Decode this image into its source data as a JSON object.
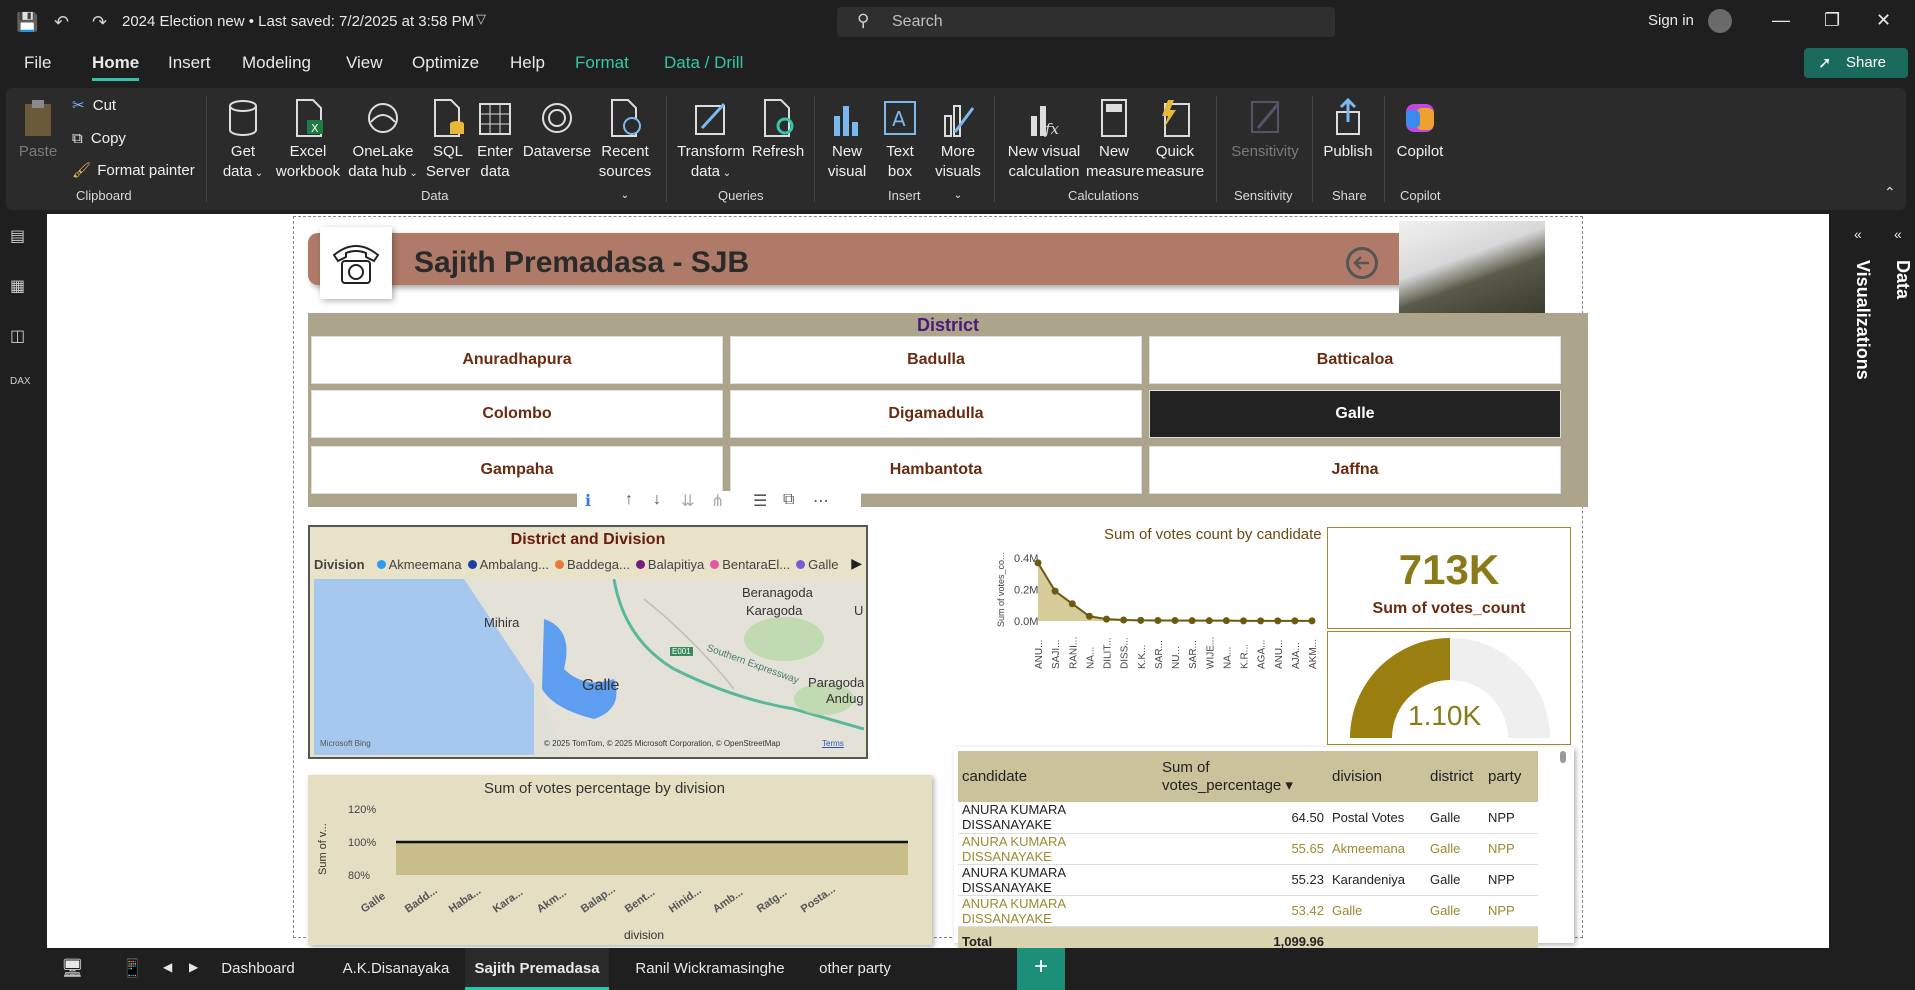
{
  "titlebar": {
    "doc_title": "2024 Election new • Last saved: 7/2/2025 at 3:58 PM",
    "search_placeholder": "Search",
    "sign_in": "Sign in"
  },
  "menu": {
    "items": [
      "File",
      "Home",
      "Insert",
      "Modeling",
      "View",
      "Optimize",
      "Help",
      "Format",
      "Data / Drill"
    ],
    "active": "Home",
    "share": "Share"
  },
  "ribbon": {
    "clipboard": {
      "paste": "Paste",
      "cut": "Cut",
      "copy": "Copy",
      "format_painter": "Format painter",
      "label": "Clipboard"
    },
    "data": {
      "get_data": [
        "Get",
        "data"
      ],
      "excel": [
        "Excel",
        "workbook"
      ],
      "onelake": [
        "OneLake",
        "data hub"
      ],
      "sql": [
        "SQL",
        "Server"
      ],
      "enter": [
        "Enter",
        "data"
      ],
      "dataverse": "Dataverse",
      "recent": [
        "Recent",
        "sources"
      ],
      "label": "Data"
    },
    "queries": {
      "transform": [
        "Transform",
        "data"
      ],
      "refresh": "Refresh",
      "label": "Queries"
    },
    "insert": {
      "new_visual": [
        "New",
        "visual"
      ],
      "text_box": [
        "Text",
        "box"
      ],
      "more": [
        "More",
        "visuals"
      ],
      "label": "Insert"
    },
    "calculations": {
      "new_visual_calc": [
        "New visual",
        "calculation"
      ],
      "new_measure": [
        "New",
        "measure"
      ],
      "quick_measure": [
        "Quick",
        "measure"
      ],
      "label": "Calculations"
    },
    "sensitivity": {
      "btn": "Sensitivity",
      "label": "Sensitivity"
    },
    "share": {
      "publish": "Publish",
      "label": "Share"
    },
    "copilot": {
      "btn": "Copilot",
      "label": "Copilot"
    }
  },
  "panes": {
    "visualizations": "Visualizations",
    "data": "Data"
  },
  "report": {
    "header_title": "Sajith Premadasa - SJB",
    "district_title": "District",
    "districts": [
      "Anuradhapura",
      "Badulla",
      "Batticaloa",
      "Colombo",
      "Digamadulla",
      "Galle",
      "Gampaha",
      "Hambantota",
      "Jaffna"
    ],
    "selected_district": "Galle",
    "map": {
      "title": "District and Division",
      "legend_label": "Division",
      "legend_items": [
        {
          "name": "Akmeemana",
          "color": "#2b9bf4"
        },
        {
          "name": "Ambalang...",
          "color": "#1f3fa8"
        },
        {
          "name": "Baddega...",
          "color": "#e8783a"
        },
        {
          "name": "Balapitiya",
          "color": "#7a1a7a"
        },
        {
          "name": "BentaraEl...",
          "color": "#e056a8"
        },
        {
          "name": "Galle",
          "color": "#7a5ad8"
        }
      ],
      "places": [
        "Beranagoda",
        "Karagoda",
        "U",
        "Mihira",
        "Galle",
        "Paragoda",
        "Andug",
        "Southern Expressway",
        "E001"
      ],
      "attribution": "© 2025 TomTom, © 2025 Microsoft Corporation, © OpenStreetMap",
      "terms": "Terms",
      "bing": "Microsoft Bing"
    },
    "kpi": {
      "value": "713K",
      "label": "Sum of votes_count"
    },
    "gauge": {
      "value": "1.10K",
      "fraction": 0.5
    }
  },
  "chart_data": [
    {
      "type": "line",
      "title": "Sum of votes count by candidate",
      "xlabel": "candidate",
      "ylabel": "Sum of votes_co...",
      "yticks": [
        "0.0M",
        "0.2M",
        "0.4M"
      ],
      "ylim": [
        0,
        0.42
      ],
      "categories": [
        "ANU...",
        "SAJI...",
        "RANI...",
        "NA...",
        "DILIT...",
        "DISS...",
        "K.K...",
        "SAR...",
        "NU...",
        "SAR...",
        "WIJE...",
        "NA...",
        "K.R...",
        "AGA...",
        "ANU...",
        "AJA...",
        "AKM..."
      ],
      "values": [
        0.37,
        0.19,
        0.11,
        0.03,
        0.012,
        0.006,
        0.004,
        0.003,
        0.003,
        0.002,
        0.002,
        0.002,
        0.001,
        0.001,
        0.001,
        0.001,
        0.001
      ]
    },
    {
      "type": "area",
      "title": "Sum of votes percentage by division",
      "xlabel": "division",
      "ylabel": "Sum of v...",
      "yticks": [
        "80%",
        "100%",
        "120%"
      ],
      "ylim": [
        80,
        120
      ],
      "categories": [
        "Galle",
        "Badd...",
        "Haba...",
        "Kara...",
        "Akm...",
        "Balap...",
        "Bent...",
        "Hinid...",
        "Amb...",
        "Ratg...",
        "Posta..."
      ],
      "values": [
        100,
        100,
        100,
        100,
        100,
        100,
        100,
        100,
        100,
        100,
        100
      ]
    },
    {
      "type": "table",
      "columns": [
        "candidate",
        "Sum of votes_percentage",
        "division",
        "district",
        "party"
      ],
      "rows": [
        [
          "ANURA KUMARA DISSANAYAKE",
          "64.50",
          "Postal Votes",
          "Galle",
          "NPP"
        ],
        [
          "ANURA KUMARA DISSANAYAKE",
          "55.65",
          "Akmeemana",
          "Galle",
          "NPP"
        ],
        [
          "ANURA KUMARA DISSANAYAKE",
          "55.23",
          "Karandeniya",
          "Galle",
          "NPP"
        ],
        [
          "ANURA KUMARA DISSANAYAKE",
          "53.42",
          "Galle",
          "Galle",
          "NPP"
        ]
      ],
      "total": [
        "Total",
        "1,099.96",
        "",
        "",
        ""
      ]
    }
  ],
  "page_tabs": [
    "Dashboard",
    "A.K.Disanayaka",
    "Sajith Premadasa",
    "Ranil Wickramasinghe",
    "other party"
  ],
  "active_page": "Sajith Premadasa"
}
